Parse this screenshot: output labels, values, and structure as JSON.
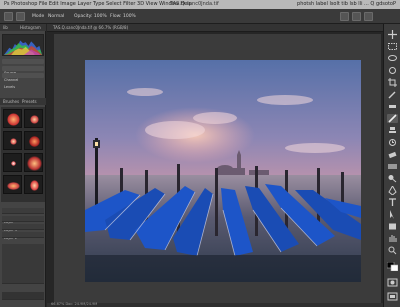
{
  "window": {
    "title": "TAS.Q.sanc0Jnda.tif",
    "menu_left": "Ps  Photoshop  File  Edit  Image  Layer  Type  Select  Filter  3D  View  Window  Help",
    "menu_right": "photsh  label  lsolt  tib  lsb  lli  ... Q  gdsotoP"
  },
  "options_bar": {
    "items": [
      "Mode",
      "Normal",
      "Opacity: 100%",
      "Flow: 100%"
    ]
  },
  "left_panel": {
    "tabs": [
      "lib",
      "Histogram"
    ],
    "tabs2": [
      "Brushes",
      "Presets"
    ],
    "histogram_colors": [
      "#d13a3a",
      "#3ac13a",
      "#3a6cd9",
      "#e0e040",
      "#c040c0"
    ],
    "rows": [
      "Source",
      "Channel",
      "Levels"
    ],
    "layer_rows": [
      "Layer",
      "Layer 1",
      "Layer 2",
      "Background"
    ]
  },
  "document": {
    "tab_label": "TAS.Q.sanc0Jnda.tif @ 66.7% (RGB/8)",
    "status": "66.67%  Doc: 24.9M/24.9M"
  },
  "photo": {
    "sky_top": "#5670a8",
    "sky_mid": "#d49aa8",
    "horizon": "#f2c9a4",
    "water": "#3d4a5f",
    "gondola": "#1d55c8"
  }
}
